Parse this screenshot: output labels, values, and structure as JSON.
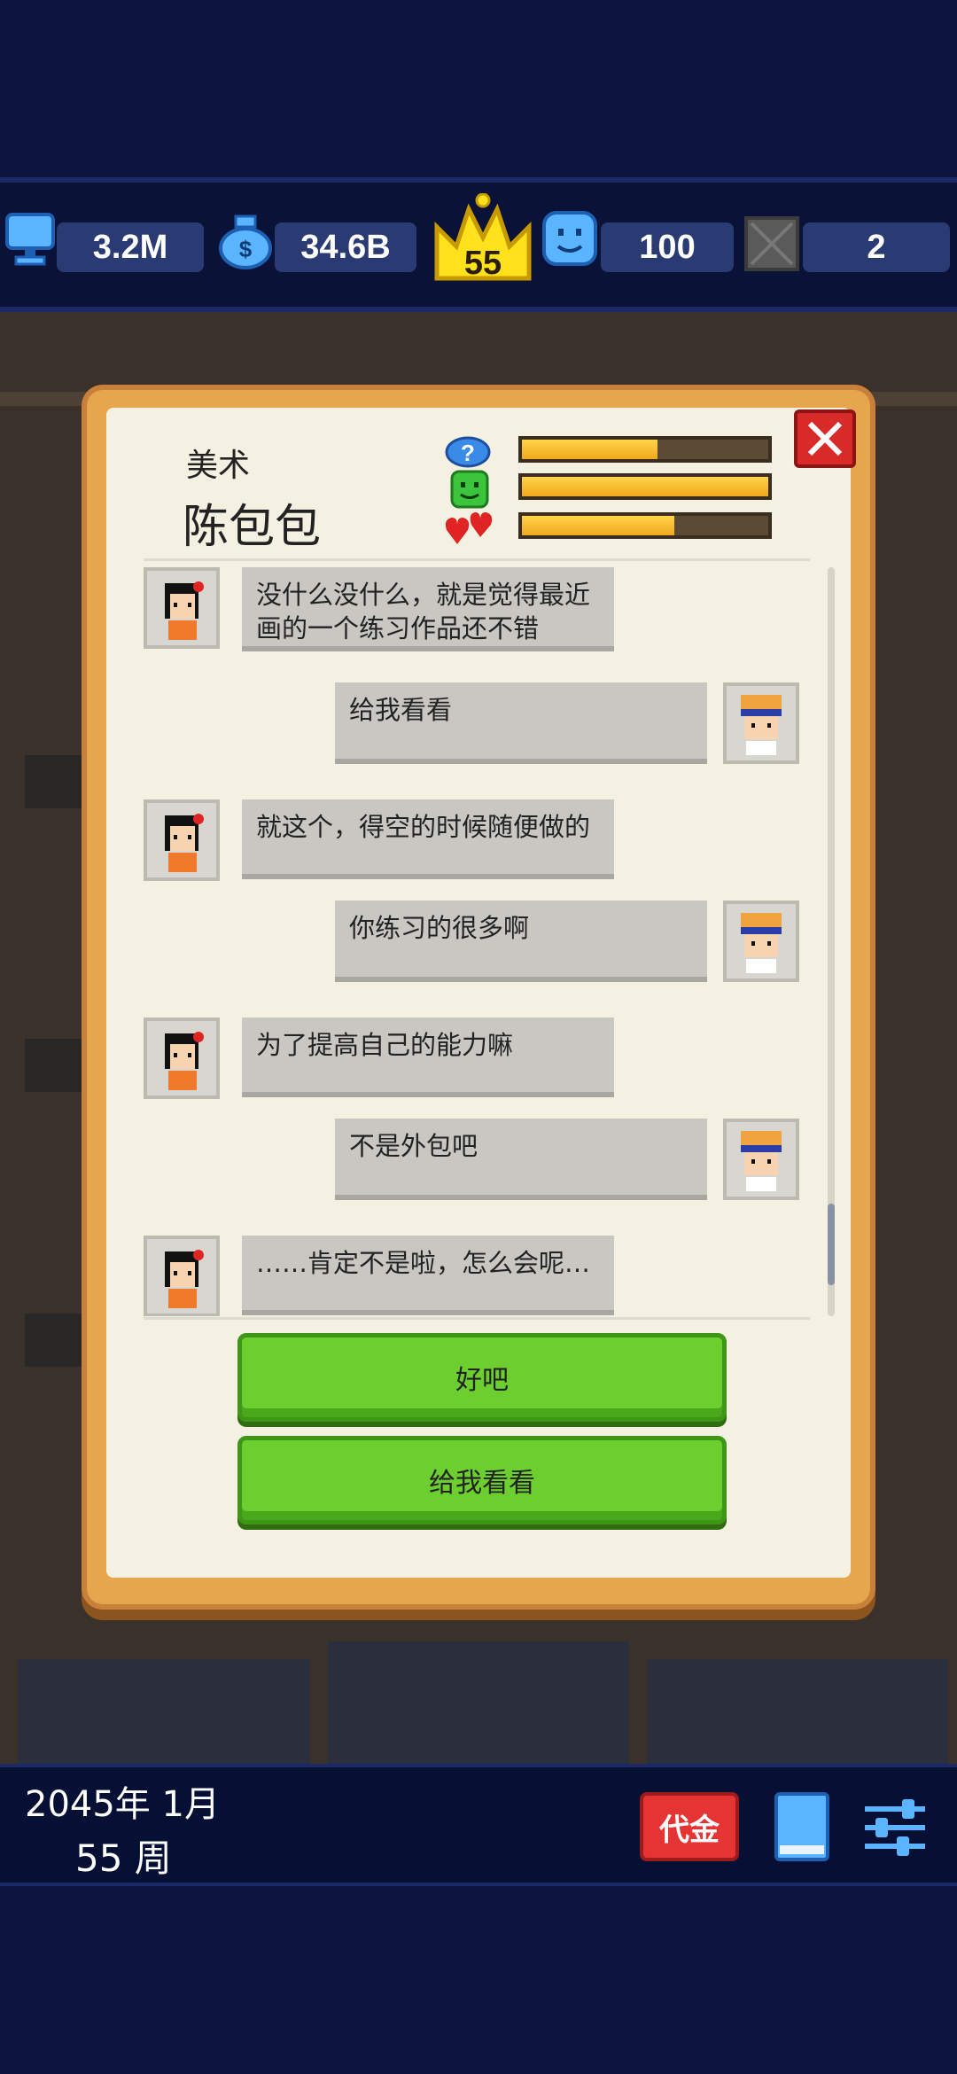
{
  "stats": {
    "computers": "3.2M",
    "money": "34.6B",
    "level": "55",
    "staff_happiness": "100",
    "locked_count": "2"
  },
  "colors": {
    "bar_fill": "#f2a81c",
    "button_green": "#6ccf2f",
    "close_red": "#d92a2a",
    "voucher_red": "#e43434"
  },
  "employee": {
    "role": "美术",
    "name": "陈包包",
    "bars": [
      {
        "icon": "question-icon",
        "level_pct": 55
      },
      {
        "icon": "green-face-icon",
        "level_pct": 100
      },
      {
        "icon": "hearts-icon",
        "level_pct": 62
      }
    ]
  },
  "chat": [
    {
      "from": "employee",
      "text": "没什么没什么，就是觉得最近画的一个练习作品还不错"
    },
    {
      "from": "player",
      "text": "给我看看"
    },
    {
      "from": "employee",
      "text": "就这个，得空的时候随便做的"
    },
    {
      "from": "player",
      "text": "你练习的很多啊"
    },
    {
      "from": "employee",
      "text": "为了提高自己的能力嘛"
    },
    {
      "from": "player",
      "text": "不是外包吧"
    },
    {
      "from": "employee",
      "text": "……肯定不是啦，怎么会呢…"
    }
  ],
  "options": {
    "option1": "好吧",
    "option2": "给我看看"
  },
  "footer": {
    "date": "2045年 1月",
    "week": "55 周",
    "voucher_label": "代金"
  }
}
